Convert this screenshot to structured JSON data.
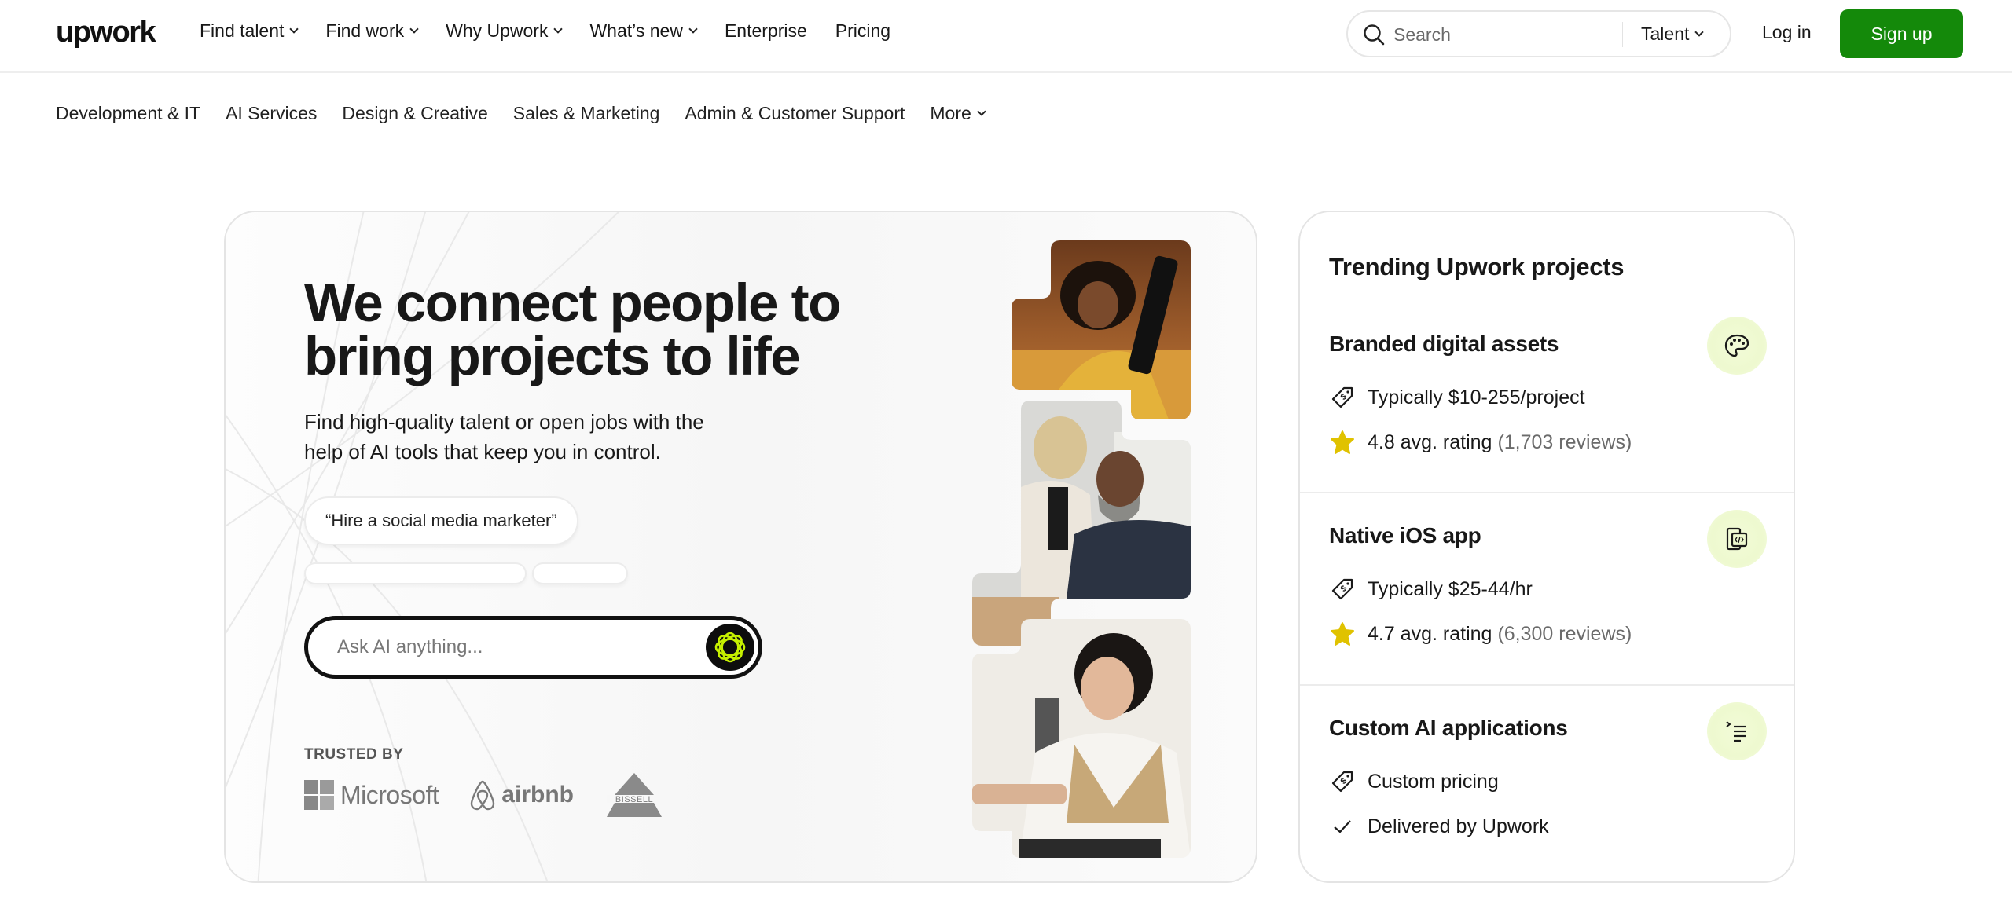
{
  "header": {
    "logo": "upwork",
    "nav": [
      {
        "label": "Find talent",
        "dropdown": true
      },
      {
        "label": "Find work",
        "dropdown": true
      },
      {
        "label": "Why Upwork",
        "dropdown": true
      },
      {
        "label": "What’s new",
        "dropdown": true
      },
      {
        "label": "Enterprise",
        "dropdown": false
      },
      {
        "label": "Pricing",
        "dropdown": false
      }
    ],
    "search": {
      "placeholder": "Search",
      "value": "",
      "scope": "Talent"
    },
    "login": "Log in",
    "signup": "Sign up",
    "brand_color": "#14890a"
  },
  "categories": {
    "items": [
      "Development & IT",
      "AI Services",
      "Design & Creative",
      "Sales & Marketing",
      "Admin & Customer Support"
    ],
    "more": "More"
  },
  "hero": {
    "headline": "We connect people to bring projects to life",
    "subline": "Find high-quality talent or open jobs with the help of AI tools that keep you in control.",
    "prompt_chip": "“Hire a social media marketer”",
    "ai_input": {
      "placeholder": "Ask AI anything...",
      "value": ""
    },
    "ai_accent": "#c6f000",
    "trusted_label": "TRUSTED BY",
    "trusted_logos": [
      "Microsoft",
      "airbnb",
      "BISSELL"
    ]
  },
  "trending": {
    "title": "Trending Upwork projects",
    "projects": [
      {
        "title": "Branded digital assets",
        "icon": "palette-icon",
        "price": "Typically $10-255/project",
        "rating": "4.8 avg. rating",
        "reviews": "(1,703 reviews)"
      },
      {
        "title": "Native iOS app",
        "icon": "mobile-code-icon",
        "price": "Typically $25-44/hr",
        "rating": "4.7 avg. rating",
        "reviews": "(6,300 reviews)"
      },
      {
        "title": "Custom AI applications",
        "icon": "prompt-list-icon",
        "price": "Custom pricing",
        "delivered": "Delivered by Upwork"
      }
    ],
    "star_color": "#e0c200",
    "icon_bg": "#eef9cf"
  }
}
